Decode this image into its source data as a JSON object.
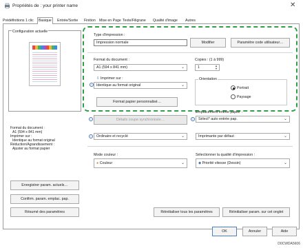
{
  "window": {
    "title": "Propriétés de : your printer name",
    "close_glyph": "✕"
  },
  "tabs": [
    "Prédéfinitions 1 clic",
    "Basique",
    "Entrée/Sortie",
    "Finition",
    "Mise en Page",
    "Texte/Filigrane",
    "Qualité d'image",
    "Autres"
  ],
  "active_tab": "Basique",
  "sidebar": {
    "title": "Configuration actuelle",
    "info": [
      "Format du document :",
      "A1 (594 x 841 mm)",
      "Imprimer sur :",
      "Identique au format original",
      "Réduction/Agrandissement :",
      "Ajuster au format papier"
    ],
    "buttons": [
      "Enregistrer param. actuels…",
      "Confirm. param. emplac. pap.",
      "Résumé des paramètres"
    ]
  },
  "print_type": {
    "label": "Type d'impression :",
    "value": "Impression normale",
    "modify_button": "Modifier",
    "user_code_button": "Paramètre code utilisateur…"
  },
  "document_size": {
    "label": "Format du document :",
    "value": "A1 (594 x 841 mm)"
  },
  "copies": {
    "label": "Copies : (1 à 999)",
    "value": "1"
  },
  "print_on": {
    "label": "Imprimer sur :",
    "value": "Identique au format original"
  },
  "orientation": {
    "label": "Orientation",
    "options": [
      "Portrait",
      "Paysage"
    ],
    "selected": "Portrait"
  },
  "custom_paper_button": "Format papier personnalisé…",
  "input_tray": {
    "label": "Emplacement entrée papier :",
    "value": "Sélect* auto entrée pap."
  },
  "sync_cut_button": "Détails coupe synchronisée…",
  "paper_type": {
    "value": "Ordinaire et recyclé"
  },
  "output": {
    "value": "Imprimante par défaut"
  },
  "color_mode": {
    "label": "Mode couleur :",
    "value": "Couleur"
  },
  "print_quality": {
    "label": "Sélectionner la qualité d'impression :",
    "value": "Priorité vitesse (Dessin)"
  },
  "reset_buttons": [
    "Réinitialiser tous les paramètres",
    "Réinitialiser param. sur cet onglet"
  ],
  "dialog_buttons": {
    "ok": "OK",
    "cancel": "Annuler",
    "help": "Aide"
  },
  "image_code": "D0CWDA5606",
  "colors": {
    "highlight": "#2e9f47",
    "accent": "#4a7fc4"
  }
}
